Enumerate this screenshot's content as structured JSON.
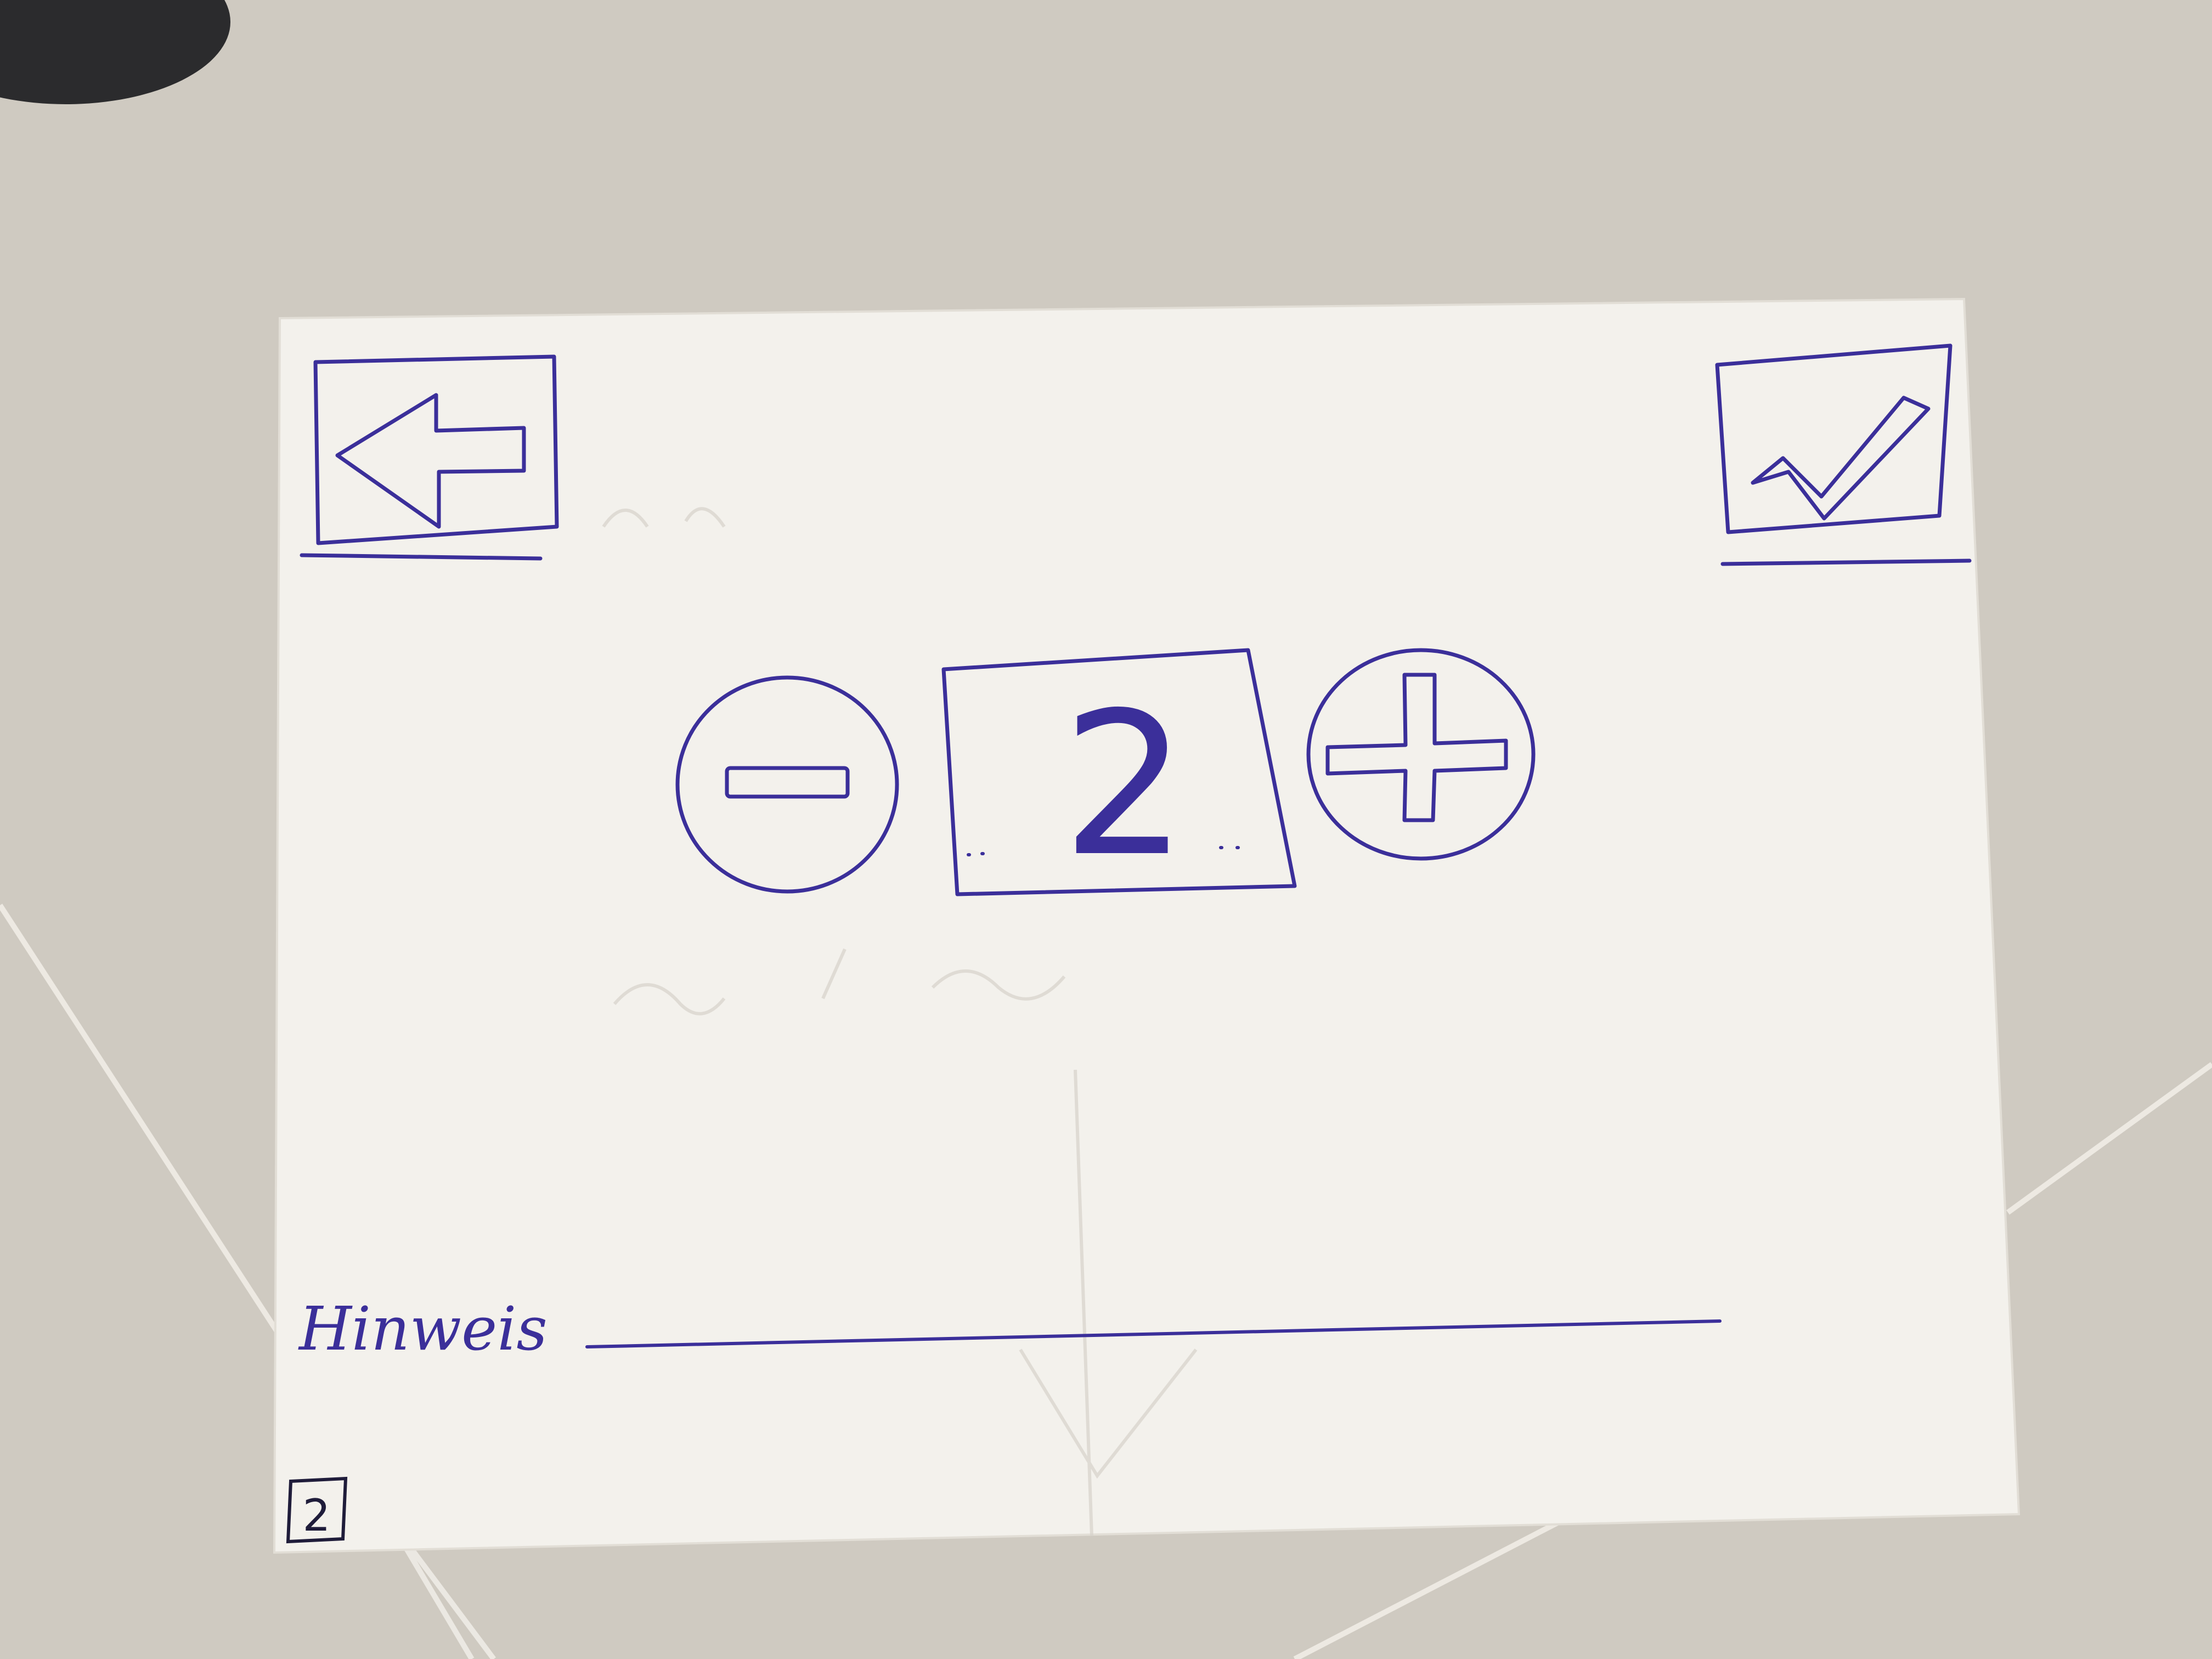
{
  "ink_color": "#3b2f9a",
  "paper_color": "#f3f1ec",
  "table_color": "#cfcac1",
  "toolbar": {
    "back_icon": "arrow-left-icon",
    "confirm_icon": "checkmark-icon"
  },
  "stepper": {
    "decrement_icon": "minus-circle-icon",
    "increment_icon": "plus-circle-icon",
    "value": "2"
  },
  "note": {
    "label": "Hinweis",
    "value": ""
  },
  "page_number": "2"
}
